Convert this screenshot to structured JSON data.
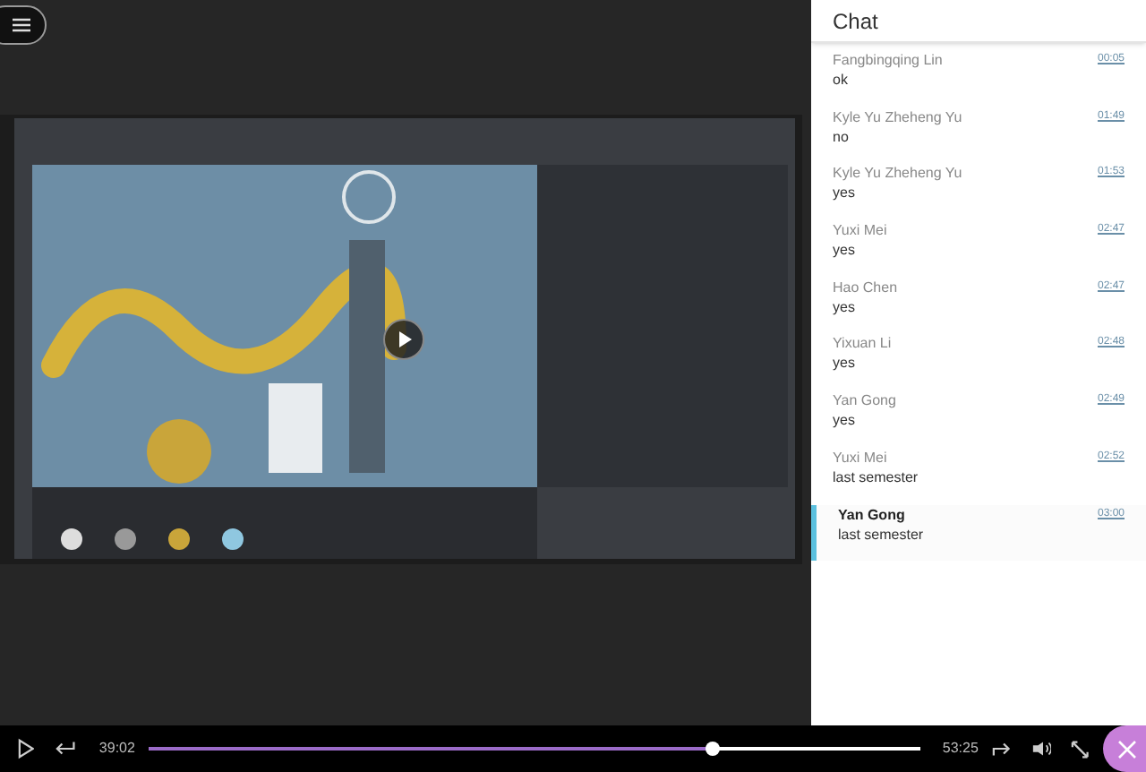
{
  "chat": {
    "title": "Chat",
    "messages": [
      {
        "author": "Fangbingqing Lin",
        "time": "00:05",
        "text": "ok",
        "selected": false
      },
      {
        "author": "Kyle Yu Zheheng Yu",
        "time": "01:49",
        "text": "no",
        "selected": false
      },
      {
        "author": "Kyle Yu Zheheng Yu",
        "time": "01:53",
        "text": "yes",
        "selected": false
      },
      {
        "author": "Yuxi Mei",
        "time": "02:47",
        "text": "yes",
        "selected": false
      },
      {
        "author": "Hao Chen",
        "time": "02:47",
        "text": "yes",
        "selected": false
      },
      {
        "author": "Yixuan Li",
        "time": "02:48",
        "text": "yes",
        "selected": false
      },
      {
        "author": "Yan Gong",
        "time": "02:49",
        "text": "yes",
        "selected": false
      },
      {
        "author": "Yuxi Mei",
        "time": "02:52",
        "text": "last semester",
        "selected": false
      },
      {
        "author": "Yan Gong",
        "time": "03:00",
        "text": "last semester",
        "selected": true
      }
    ]
  },
  "player": {
    "elapsed": "39:02",
    "duration": "53:25",
    "level": 0.73
  }
}
